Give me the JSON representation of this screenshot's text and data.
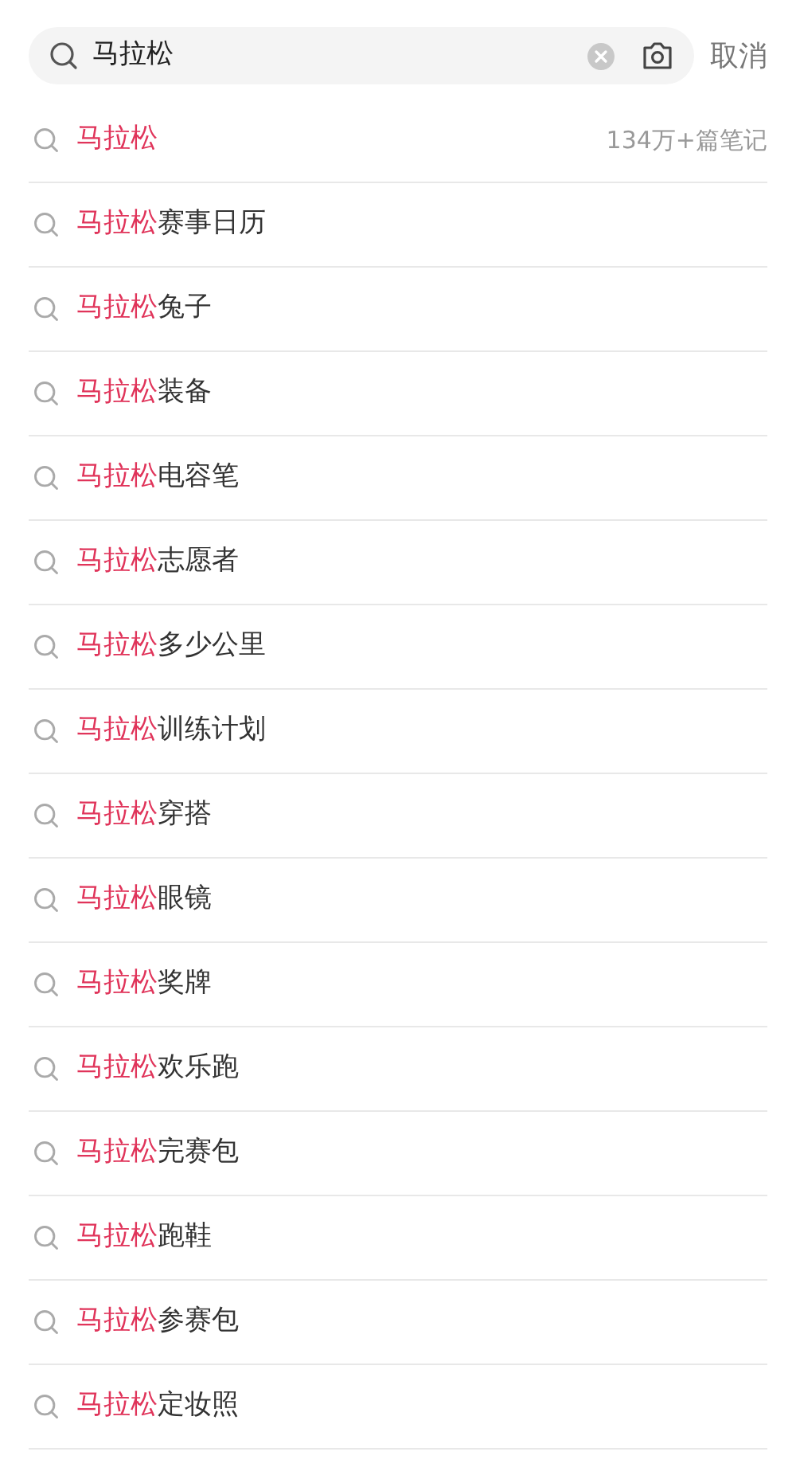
{
  "search": {
    "value": "马拉松",
    "cancel": "取消"
  },
  "suggestions": [
    {
      "match": "马拉松",
      "count": "134万+篇笔记"
    },
    {
      "match": "马拉松",
      "rest": "赛事日历"
    },
    {
      "match": "马拉松",
      "rest": "兔子"
    },
    {
      "match": "马拉松",
      "rest": "装备"
    },
    {
      "match": "马拉松",
      "rest": "电容笔"
    },
    {
      "match": "马拉松",
      "rest": "志愿者"
    },
    {
      "match": "马拉松",
      "rest": "多少公里"
    },
    {
      "match": "马拉松",
      "rest": "训练计划"
    },
    {
      "match": "马拉松",
      "rest": "穿搭"
    },
    {
      "match": "马拉松",
      "rest": "眼镜"
    },
    {
      "match": "马拉松",
      "rest": "奖牌"
    },
    {
      "match": "马拉松",
      "rest": "欢乐跑"
    },
    {
      "match": "马拉松",
      "rest": "完赛包"
    },
    {
      "match": "马拉松",
      "rest": "跑鞋"
    },
    {
      "match": "马拉松",
      "rest": "参赛包"
    },
    {
      "match": "马拉松",
      "rest": "定妆照"
    }
  ]
}
